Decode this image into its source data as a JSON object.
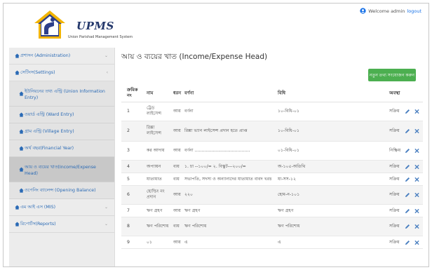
{
  "colors": {
    "brand_navy": "#23376b",
    "link_blue": "#2a6ab5",
    "action_green": "#4caf50"
  },
  "header": {
    "app_name": "UPMS",
    "app_subtitle": "Union Parishad Management System",
    "welcome_text": "Welcome admin",
    "logout_label": "logout"
  },
  "sidebar": {
    "items": [
      {
        "label": "প্রশাসন (Administration)",
        "icon": "home-icon"
      },
      {
        "label": "সেটিংস(Settings)",
        "icon": "home-icon"
      },
      {
        "label": "এম আই এস (MIS)",
        "icon": "home-icon"
      },
      {
        "label": "রিপোর্টস(Reports)",
        "icon": "home-icon"
      }
    ],
    "settings_sub": [
      {
        "label": "ইউনিয়নের তথ্য এন্ট্রি (Union Information Entry)"
      },
      {
        "label": "ওয়ার্ড এন্ট্রি (Ward Entry)"
      },
      {
        "label": "গ্রাম এন্ট্রি (Village Entry)"
      },
      {
        "label": "অর্থ বছর(Financial Year)"
      },
      {
        "label": "আয় ও ব্যয়ের খাত(Income/Expense Head)"
      },
      {
        "label": "ওপেনিং ব্যালেন্স (Opening Balance)"
      }
    ]
  },
  "main": {
    "title": "আয় ও ব্যয়ের খাত (Income/Expense Head)",
    "add_button": "নতুন তথ্য সংযোজন করুন",
    "table": {
      "headers": {
        "serial": "ক্রমিক নং",
        "name": "নাম",
        "type": "ধরন",
        "desc": "বর্ণনা",
        "rule": "বিধি",
        "status": "অবস্থা"
      },
      "rows": [
        {
          "serial": "1",
          "name": "ট্রেড লাইসেন্স",
          "type": "আয়",
          "desc": "বর্ণনা",
          "rule": "১০-বিধি-০১",
          "status": "সক্রিয়"
        },
        {
          "serial": "2",
          "name": "রিক্সা লাইসেন্স",
          "type": "আয়",
          "desc": "রিক্সা ভ্যান লাইসেন্স প্রদান হতে প্রাপ্ত",
          "rule": "১০-বিধি-০১",
          "status": "সক্রিয়"
        },
        {
          "serial": "3",
          "name": "কর আদায়",
          "type": "আয়",
          "desc": "বর্ণনা ........................................",
          "rule": "০১-বিধি-০১",
          "status": "নিষ্ক্রিয়"
        },
        {
          "serial": "4",
          "name": "অপ্যায়ন",
          "type": "ব্যয়",
          "desc": "১. চা --১০০/= ২. বিস্কুট---২০০/=",
          "rule": "অ-১০৫-অতিথি",
          "status": "সক্রিয়"
        },
        {
          "serial": "5",
          "name": "যাতায়াত",
          "type": "ব্যয়",
          "desc": "সভাপতি, সদস্য ও অন্যান্যদের যাতায়াত বাবদ খরচ",
          "rule": "যা-সস-১২",
          "status": "সক্রিয়"
        },
        {
          "serial": "6",
          "name": "হোল্ডিং নং প্রদান",
          "type": "আয়",
          "desc": "২২০",
          "rule": "হোম-ন-১০১",
          "status": "সক্রিয়"
        },
        {
          "serial": "7",
          "name": "ঋণ গ্রহণ",
          "type": "আয়",
          "desc": "ঋণ গ্রহণ",
          "rule": "ঋণ গ্রহণ",
          "status": "সক্রিয়"
        },
        {
          "serial": "8",
          "name": "ঋণ পরিশোধ",
          "type": "ব্যয়",
          "desc": "ঋণ পরিশোধ",
          "rule": "ঋণ পরিশোধ",
          "status": "সক্রিয়"
        },
        {
          "serial": "9",
          "name": "০১",
          "type": "আয়",
          "desc": "এ",
          "rule": "এ",
          "status": "সক্রিয়"
        }
      ]
    }
  }
}
